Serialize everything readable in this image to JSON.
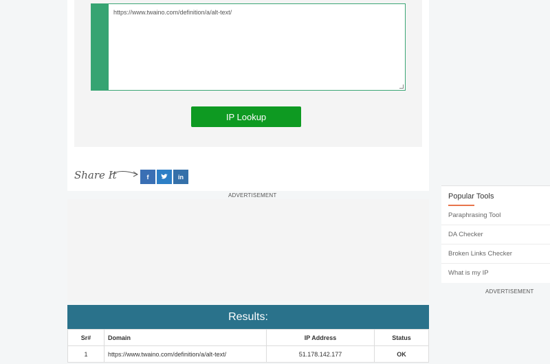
{
  "url_input": {
    "value": "https://www.twaino.com/definition/a/alt-text/"
  },
  "lookup_button": {
    "label": "IP Lookup"
  },
  "share": {
    "label": "Share It",
    "buttons": [
      {
        "name": "facebook",
        "glyph": "f"
      },
      {
        "name": "twitter",
        "glyph": "t"
      },
      {
        "name": "linkedin",
        "glyph": "in"
      }
    ]
  },
  "ads": {
    "label_main": "ADVERTISEMENT",
    "label_side": "ADVERTISEMENT"
  },
  "results": {
    "title": "Results:",
    "columns": [
      "Sr#",
      "Domain",
      "IP Address",
      "Status"
    ],
    "rows": [
      {
        "sr": "1",
        "domain": "https://www.twaino.com/definition/a/alt-text/",
        "ip": "51.178.142.177",
        "status": "OK"
      }
    ]
  },
  "sidebar": {
    "title": "Popular Tools",
    "items": [
      "Paraphrasing Tool",
      "DA Checker",
      "Broken Links Checker",
      "What is my IP"
    ]
  },
  "colors": {
    "accent_green": "#0e9a22",
    "results_header": "#2a728b",
    "sidebar_underline": "#e8734a"
  }
}
